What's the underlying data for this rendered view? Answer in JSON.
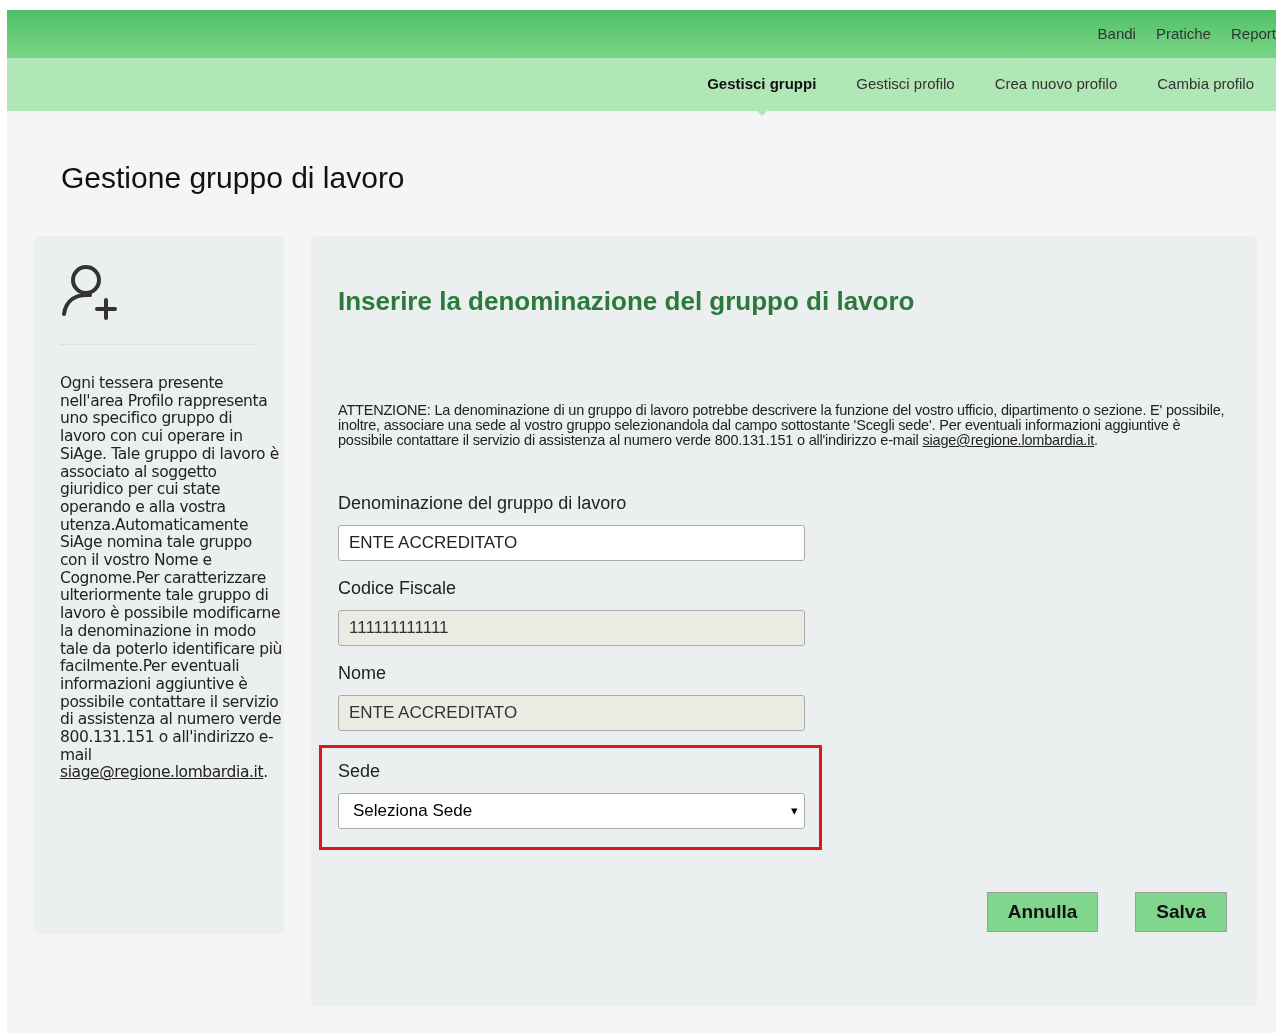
{
  "top_nav": {
    "items": [
      {
        "label": "Bandi"
      },
      {
        "label": "Pratiche"
      },
      {
        "label": "Report"
      }
    ]
  },
  "sub_nav": {
    "items": [
      {
        "label": "Gestisci gruppi",
        "selected": true
      },
      {
        "label": "Gestisci profilo",
        "selected": false
      },
      {
        "label": "Crea nuovo profilo",
        "selected": false
      },
      {
        "label": "Cambia profilo",
        "selected": false
      }
    ]
  },
  "page_title": "Gestione gruppo di lavoro",
  "sidebar": {
    "text": "Ogni tessera presente nell'area Profilo rappresenta uno specifico gruppo di lavoro con cui operare in SiAge. Tale gruppo di lavoro è associato al soggetto giuridico per cui state operando e alla vostra utenza.Automaticamente SiAge nomina tale gruppo con il vostro Nome e Cognome.Per caratterizzare ulteriormente tale gruppo di lavoro è possibile modificarne la denominazione in modo tale da poterlo identificare più facilmente.Per eventuali informazioni aggiuntive è possibile contattare il servizio di assistenza al numero verde 800.131.151 o all'indirizzo e-mail",
    "link": "siage@regione.lombardia.it",
    "suffix": "."
  },
  "form": {
    "heading": "Inserire la denominazione del gruppo di lavoro",
    "notice": {
      "text": "ATTENZIONE: La denominazione di un gruppo di lavoro potrebbe descrivere la funzione del vostro ufficio, dipartimento o sezione. E' possibile, inoltre, associare una sede al vostro gruppo selezionandola dal campo sottostante 'Scegli sede'. Per eventuali informazioni aggiuntive è possibile contattare il servizio di assistenza al numero verde 800.131.151 o all'indirizzo e-mail",
      "link": "siage@regione.lombardia.it",
      "suffix": "."
    },
    "fields": [
      {
        "kind": "text",
        "label": "Denominazione del gruppo di lavoro",
        "value": "ENTE ACCREDITATO",
        "disabled": false,
        "highlighted": false
      },
      {
        "kind": "text",
        "label": "Codice Fiscale",
        "value": "111111111111",
        "disabled": true,
        "highlighted": false
      },
      {
        "kind": "text",
        "label": "Nome",
        "value": "ENTE ACCREDITATO",
        "disabled": true,
        "highlighted": false
      },
      {
        "kind": "select",
        "label": "Sede",
        "value": "Seleziona Sede",
        "caret": "▾",
        "disabled": false,
        "highlighted": true
      }
    ],
    "buttons": [
      {
        "label": "Annulla"
      },
      {
        "label": "Salva"
      }
    ]
  }
}
